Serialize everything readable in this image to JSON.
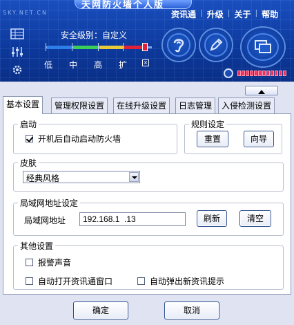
{
  "window": {
    "title": "天网防火墙个人版",
    "site": "SKY.NET.CN"
  },
  "menu": {
    "items": [
      "资讯通",
      "升级",
      "关于",
      "帮助"
    ]
  },
  "security": {
    "label": "安全级别：自定义",
    "levels": [
      "低",
      "中",
      "高",
      "扩"
    ]
  },
  "tabs": [
    "基本设置",
    "管理权限设置",
    "在线升级设置",
    "日志管理",
    "入侵检测设置"
  ],
  "startup": {
    "legend": "启动",
    "autostart_label": "开机后自动启动防火墙",
    "autostart_checked": true
  },
  "rules": {
    "legend": "规则设定",
    "reset_label": "重置",
    "wizard_label": "向导"
  },
  "skin": {
    "legend": "皮肤",
    "selected": "经典风格"
  },
  "lan": {
    "legend": "局域网地址设定",
    "address_label": "局域网地址",
    "address_value": "192.168.1  .13",
    "refresh_label": "刷新",
    "clear_label": "清空"
  },
  "other": {
    "legend": "其他设置",
    "alarm_sound": "报警声音",
    "open_news_window": "自动打开资讯通窗口",
    "popup_news": "自动弹出新资讯提示"
  },
  "footer": {
    "ok_label": "确定",
    "cancel_label": "取消"
  },
  "colors": {
    "header_blue": "#0d3a9e",
    "accent_red": "#e1203b"
  }
}
